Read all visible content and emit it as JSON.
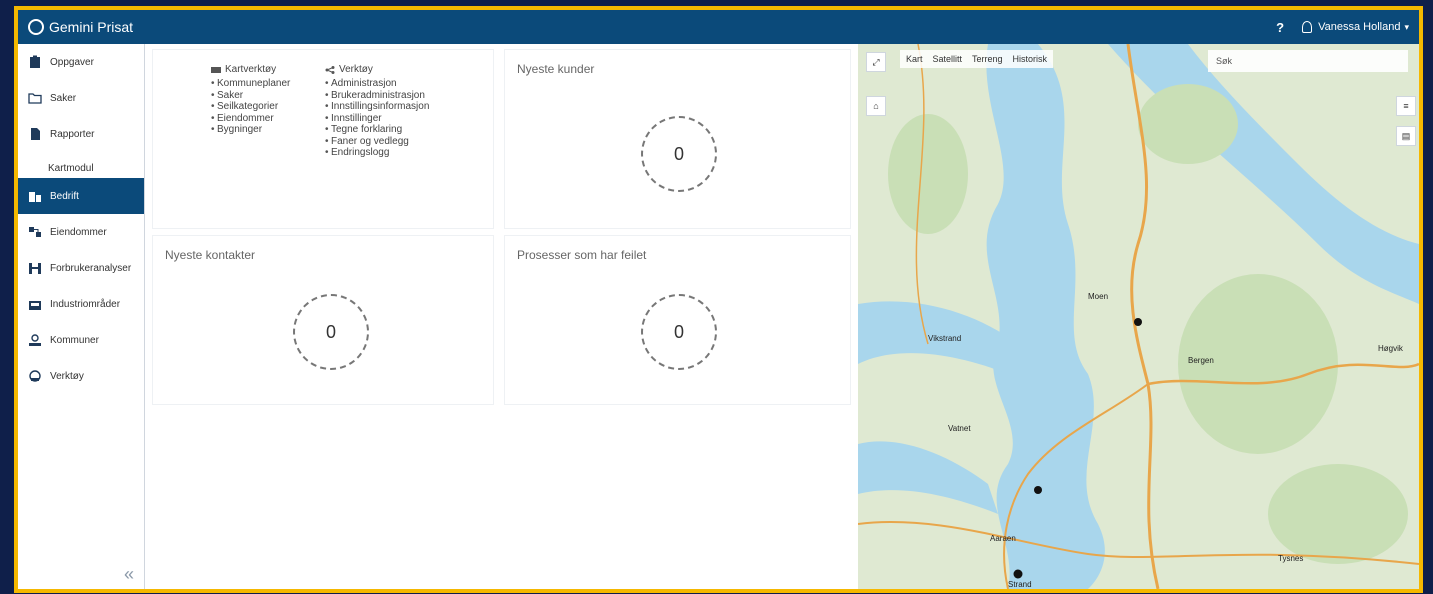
{
  "app": {
    "title": "Gemini Prisat"
  },
  "topbar": {
    "help": "?",
    "user": "Vanessa Holland",
    "user_chevron": "▾"
  },
  "sidebar": {
    "items_top": [
      {
        "label": "Oppgaver",
        "icon": "clipboard-icon"
      },
      {
        "label": "Saker",
        "icon": "folder-icon"
      },
      {
        "label": "Rapporter",
        "icon": "document-icon"
      }
    ],
    "section": "Kartmodul",
    "items_bottom": [
      {
        "label": "Bedrift",
        "icon": "building-icon",
        "active": true
      },
      {
        "label": "Eiendommer",
        "icon": "property-icon"
      },
      {
        "label": "Forbrukeranalyser",
        "icon": "chart-icon"
      },
      {
        "label": "Industriområder",
        "icon": "factory-icon"
      },
      {
        "label": "Kommuner",
        "icon": "municipality-icon"
      },
      {
        "label": "Verktøy",
        "icon": "tools-icon"
      }
    ],
    "collapse": "«"
  },
  "links": {
    "col1": {
      "title": "Kartverktøy",
      "items": [
        "Kommuneplaner",
        "Saker",
        "Seilkategorier",
        "Eiendommer",
        "Bygninger"
      ]
    },
    "col2": {
      "title": "Verktøy",
      "items": [
        "Administrasjon",
        "Brukeradministrasjon",
        "Innstillingsinformasjon",
        "Innstillinger",
        "Tegne forklaring",
        "Faner og vedlegg",
        "Endringslogg"
      ]
    }
  },
  "panels": [
    {
      "title": "Nyeste kunder",
      "value": "0"
    },
    {
      "title": "Nyeste kontakter",
      "value": "0"
    },
    {
      "title": "Prosesser som har feilet",
      "value": "0"
    }
  ],
  "map": {
    "tabs": [
      "Kart",
      "Satellitt",
      "Terreng",
      "Historisk"
    ],
    "search_placeholder": "Søk",
    "labels": [
      "Moen",
      "Vikstrand",
      "Bergen",
      "Høgvik",
      "Aaraen",
      "Vatnet",
      "Tysnes",
      "Strand"
    ],
    "colors": {
      "water": "#a9d6ec",
      "land": "#dfe9d2",
      "forest": "#c9dfb6",
      "road": "#e8a64b"
    }
  }
}
